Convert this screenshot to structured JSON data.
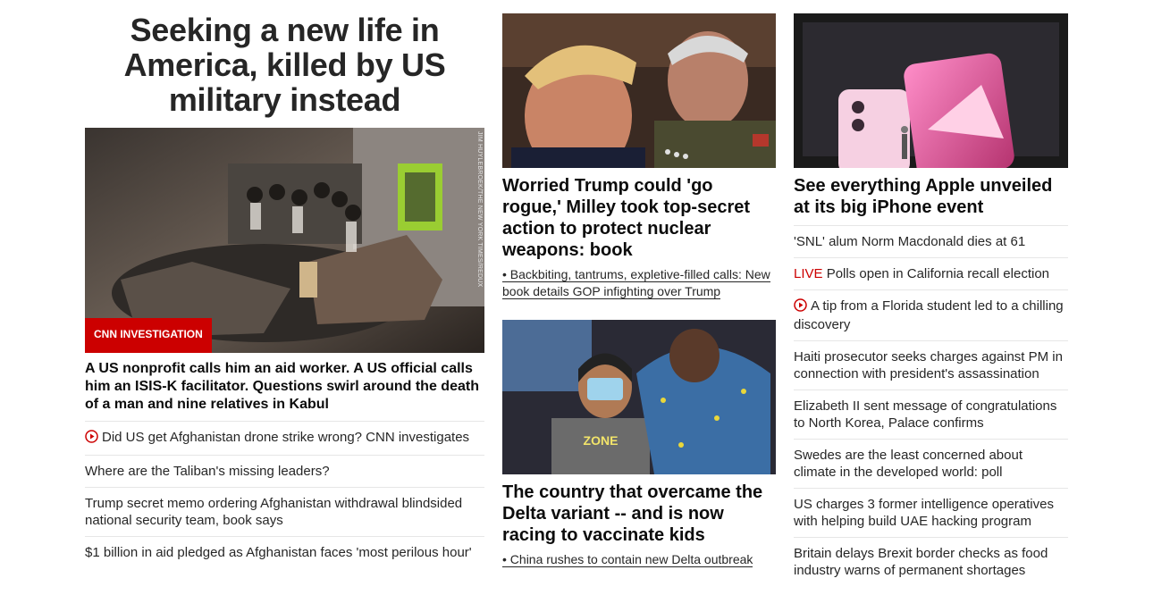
{
  "col1": {
    "headline": "Seeking a new life in America, killed by US military instead",
    "image_credit": "JIM HUYLEBROEK/THE NEW YORK TIMES/REDUX",
    "badge": "CNN INVESTIGATION",
    "description": "A US nonprofit calls him an aid worker. A US official calls him an ISIS-K facilitator. Questions swirl around the death of a man and nine relatives in Kabul",
    "links": [
      {
        "text": "Did US get Afghanistan drone strike wrong? CNN investigates",
        "icon": "play-icon"
      },
      {
        "text": "Where are the Taliban's missing leaders?"
      },
      {
        "text": "Trump secret memo ordering Afghanistan withdrawal blindsided national security team, book says"
      },
      {
        "text": "$1 billion in aid pledged as Afghanistan faces 'most perilous hour'"
      }
    ]
  },
  "col2": {
    "story1": {
      "title": "Worried Trump could 'go rogue,' Milley took top-secret action to protect nuclear weapons: book",
      "sub": "• Backbiting, tantrums, expletive-filled calls: New book details GOP infighting over Trump"
    },
    "story2": {
      "title": "The country that overcame the Delta variant -- and is now racing to vaccinate kids",
      "sub": "• China rushes to contain new Delta outbreak"
    }
  },
  "col3": {
    "title": "See everything Apple unveiled at its big iPhone event",
    "links": [
      {
        "text": "'SNL' alum Norm Macdonald dies at 61"
      },
      {
        "live": "LIVE",
        "text": " Polls open in California recall election"
      },
      {
        "text": "A tip from a Florida student led to a chilling discovery",
        "icon": "play-icon"
      },
      {
        "text": "Haiti prosecutor seeks charges against PM in connection with president's assassination"
      },
      {
        "text": "Elizabeth II sent message of congratulations to North Korea, Palace confirms"
      },
      {
        "text": "Swedes are the least concerned about climate in the developed world: poll"
      },
      {
        "text": "US charges 3 former intelligence operatives with helping build UAE hacking program"
      },
      {
        "text": "Britain delays Brexit border checks as food industry warns of permanent shortages"
      }
    ]
  },
  "colors": {
    "accent": "#cc0000",
    "text": "#262626",
    "divider": "#e6e6e6"
  }
}
